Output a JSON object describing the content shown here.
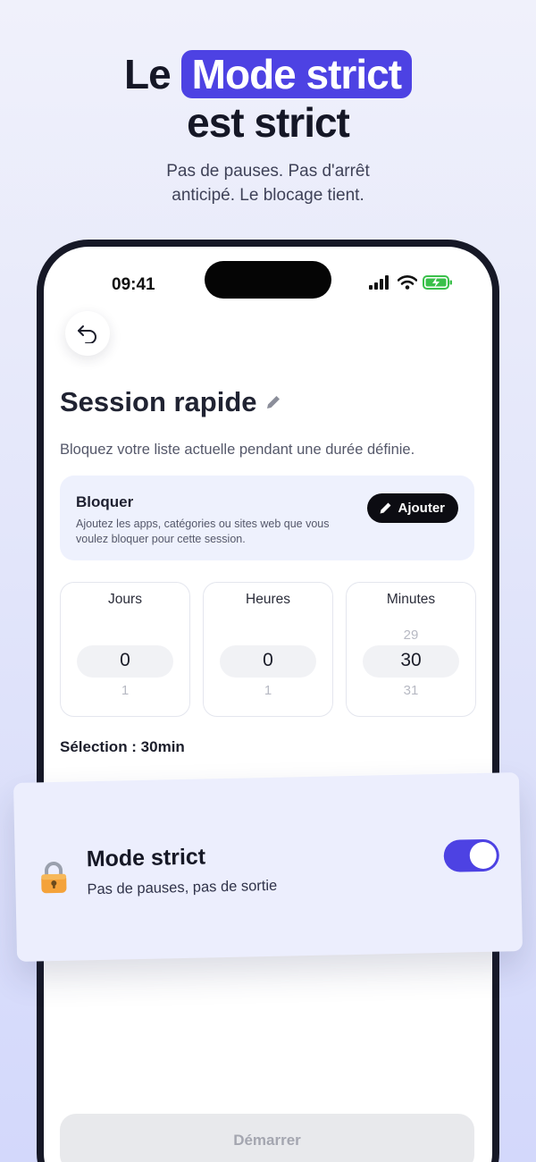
{
  "marketing": {
    "headline_prefix": "Le",
    "headline_highlight": "Mode strict",
    "headline_line2": "est strict",
    "subtitle_line1": "Pas de pauses. Pas d'arrêt",
    "subtitle_line2": "anticipé. Le blocage tient.",
    "accent_color": "#4d42e3"
  },
  "status_bar": {
    "time": "09:41",
    "icons": [
      "signal-icon",
      "wifi-icon",
      "battery-charging-icon"
    ]
  },
  "screen": {
    "back_icon": "back-arrow-icon",
    "title": "Session rapide",
    "edit_icon": "pencil-icon",
    "description": "Bloquez votre liste actuelle pendant une durée définie.",
    "block": {
      "title": "Bloquer",
      "subtitle": "Ajoutez les apps, catégories ou sites web que vous voulez bloquer pour cette session.",
      "add_label": "Ajouter"
    },
    "pickers": [
      {
        "label": "Jours",
        "prev": "",
        "value": "0",
        "next": "1"
      },
      {
        "label": "Heures",
        "prev": "",
        "value": "0",
        "next": "1"
      },
      {
        "label": "Minutes",
        "prev": "29",
        "value": "30",
        "next": "31"
      }
    ],
    "selection": "Sélection : 30min",
    "start_label": "Démarrer"
  },
  "strict_mode": {
    "title": "Mode strict",
    "subtitle": "Pas de pauses, pas de sortie",
    "enabled": true,
    "icon": "lock-icon"
  }
}
